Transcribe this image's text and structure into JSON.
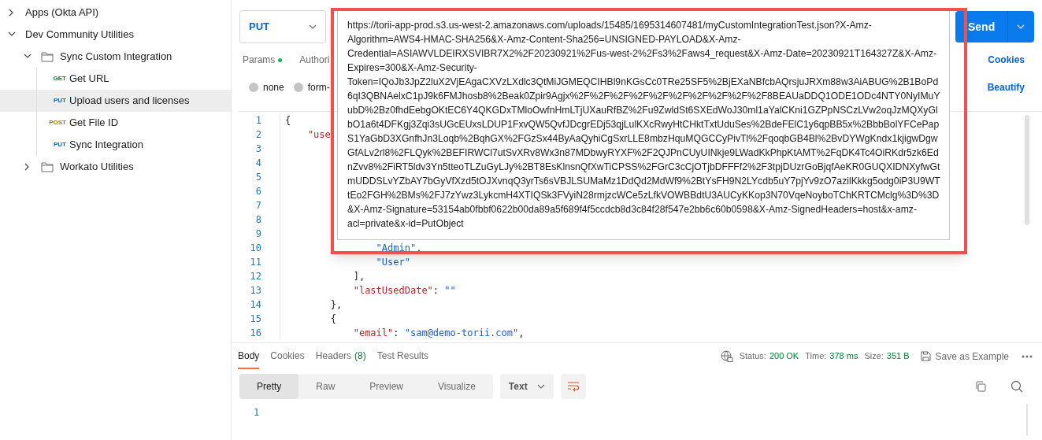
{
  "sidebar": {
    "items": [
      {
        "label": "Apps (Okta API)",
        "kind": "collection",
        "expanded": false
      },
      {
        "label": "Dev Community Utilities",
        "kind": "collection",
        "expanded": true,
        "children": [
          {
            "label": "Sync Custom Integration",
            "kind": "folder",
            "expanded": true,
            "children": [
              {
                "label": "Get URL",
                "kind": "request",
                "method": "GET",
                "selected": false
              },
              {
                "label": "Upload users and licenses",
                "kind": "request",
                "method": "PUT",
                "selected": true
              },
              {
                "label": "Get File ID",
                "kind": "request",
                "method": "POST",
                "selected": false
              },
              {
                "label": "Sync Integration",
                "kind": "request",
                "method": "PUT",
                "selected": false
              }
            ]
          },
          {
            "label": "Workato Utilities",
            "kind": "folder",
            "expanded": false
          }
        ]
      }
    ]
  },
  "request": {
    "method": "PUT",
    "send": "Send",
    "tabs": [
      {
        "label": "Params",
        "dot": true
      },
      {
        "label": "Authori"
      }
    ],
    "cookies": "Cookies",
    "body_types": [
      {
        "label": "none",
        "selected": false
      },
      {
        "label": "form-",
        "selected": false
      }
    ],
    "beautify": "Beautify",
    "url_popup": {
      "text": "https://torii-app-prod.s3.us-west-2.amazonaws.com/uploads/15485/1695314607481/myCustomIntegrationTest.json?X-Amz-Algorithm=AWS4-HMAC-SHA256&X-Amz-Content-Sha256=UNSIGNED-PAYLOAD&X-Amz-Credential=ASIAWVLDEIRXSVIBR7X2%2F20230921%2Fus-west-2%2Fs3%2Faws4_request&X-Amz-Date=20230921T164327Z&X-Amz-Expires=300&X-Amz-Security-Token=IQoJb3JpZ2luX2VjEAgaCXVzLXdlc3QtMiJGMEQCIHBl9nKGsCc0TRe25SF5%2BjEXaNBfcbAQrsjuJRXm88w3AiABUG%2B1BoPd6qI3QBNAelxC1pJ9k6FMJhosb8%2Beak0Zpir9Agjx%2F%2F%2F%2F%2F%2F%2F%2F%2F%2F8BEAUaDDQ1ODE1ODc4NTY0NyIMuYubD%2Bz0fhdEebgOKtEC6Y4QKGDxTMloOwfnHmLTjUXauRfBZ%2Fu9ZwldSt6SXEdWoJ30ml1aYalCKni1GZPpNSCzLVw2oqJzMQXyGlbO1a6t4DFKgj3Zqi3sUGcEUxsLDUP1FxvQW5QvfJDcgrEDj53qjLulKXcRwyHtCHktTxtUduSes%2BdeFElC1y6qpBB5x%2BbbBolYFCePapS1YaGbD3XGnfhJn3Loqb%2BqhGX%2FGzSx44ByAaQyhiCgSxrLLE8mbzHquMQGCCyPivTl%2FqoqbGB4Bl%2BvDYWgKndx1kjigwDgwGfALv2rl8%2FLQyk%2BEFIRWCl7utSvXRv8Wx3n87MDbwyRYXF%2F2QJPnCUyUINkje9LWadKkPhpKtAMT%2FqDK4Tc4OiRKdr5zk6EdnZvv8%2FiRT5ldv3Yn5tteoTLZuGyLJy%2BT8EsKlnsnQfXwTiCPSS%2FGrC3cCjOTjbDFFFf2%2F3tpjDUzrGoBjqfAeKR0GUQXIDNXyfwGtmUDDSLvYZbAY7bGyVfXzd5tOJXvnqQ3yrTs6sVBJLSUMaMz1DdQd2MdWf9%2BtYsFH9N2LYcdb5uY7pjYv9zO7azilKkkg5odg0iP3U9WTtEo2FGH%2BMs%2FJ7zYwz3LykcmH4XTIQSk3FVyiN28rmjzcWCe5zLfkVOWBBdtU3AUCyKKop3N70VqeNoyboTChKRTCMclg%3D%3D&X-Amz-Signature=53154ab0fbbf0622b00da89a5f689f4f5ccdcb8d3c84f28f547e2bb6c60b0598&X-Amz-SignedHeaders=host&x-amz-acl=private&x-id=PutObject"
    },
    "editor": {
      "lines": [
        {
          "number": "1",
          "tokens": [
            {
              "kind": "punct",
              "text": "{"
            }
          ]
        },
        {
          "number": "2",
          "tokens": [
            {
              "kind": "key",
              "text": "    \"use"
            }
          ]
        },
        {
          "number": "3"
        },
        {
          "number": "4"
        },
        {
          "number": "5"
        },
        {
          "number": "6"
        },
        {
          "number": "7"
        },
        {
          "number": "8"
        },
        {
          "number": "9"
        },
        {
          "number": "10",
          "tokens": [
            {
              "kind": "string",
              "text": "                \"Admin\""
            },
            {
              "kind": "punct",
              "text": ","
            }
          ]
        },
        {
          "number": "11",
          "tokens": [
            {
              "kind": "string",
              "text": "                \"User\""
            }
          ]
        },
        {
          "number": "12",
          "tokens": [
            {
              "kind": "punct",
              "text": "            ],"
            }
          ]
        },
        {
          "number": "13",
          "tokens": [
            {
              "kind": "key",
              "text": "            \"lastUsedDate\""
            },
            {
              "kind": "punct",
              "text": ": "
            },
            {
              "kind": "string",
              "text": "\"\""
            }
          ]
        },
        {
          "number": "14",
          "tokens": [
            {
              "kind": "punct",
              "text": "        },"
            }
          ]
        },
        {
          "number": "15",
          "tokens": [
            {
              "kind": "punct",
              "text": "        {"
            }
          ]
        },
        {
          "number": "16",
          "tokens": [
            {
              "kind": "key",
              "text": "            \"email\""
            },
            {
              "kind": "punct",
              "text": ": "
            },
            {
              "kind": "string",
              "text": "\"sam@demo-torii.com\""
            },
            {
              "kind": "punct",
              "text": ","
            }
          ]
        }
      ]
    }
  },
  "response": {
    "tabs": [
      {
        "label": "Body",
        "selected": true
      },
      {
        "label": "Cookies",
        "selected": false
      },
      {
        "label": "Headers",
        "count": "(8)",
        "selected": false
      },
      {
        "label": "Test Results",
        "selected": false
      }
    ],
    "status_label": "Status:",
    "status": "200 OK",
    "time_label": "Time:",
    "time": "378 ms",
    "size_label": "Size:",
    "size": "351 B",
    "save": "Save as Example",
    "views": [
      {
        "label": "Pretty",
        "selected": true
      },
      {
        "label": "Raw",
        "selected": false
      },
      {
        "label": "Preview",
        "selected": false
      },
      {
        "label": "Visualize",
        "selected": false
      }
    ],
    "format": "Text",
    "lines": [
      "1"
    ]
  }
}
